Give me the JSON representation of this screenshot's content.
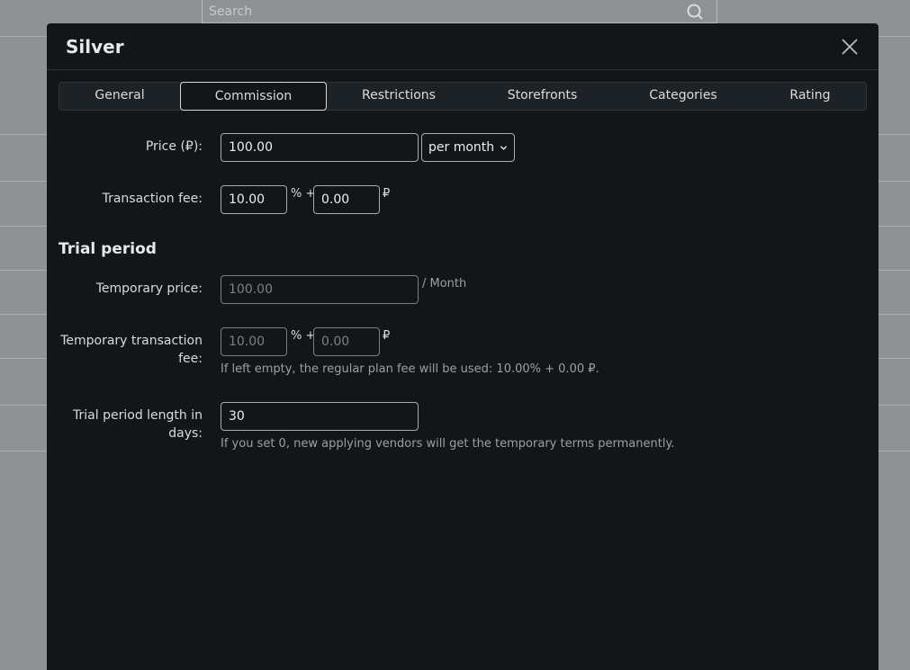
{
  "background": {
    "search_placeholder": "Search"
  },
  "modal": {
    "title": "Silver",
    "tabs": [
      {
        "label": "General"
      },
      {
        "label": "Commission"
      },
      {
        "label": "Restrictions"
      },
      {
        "label": "Storefronts"
      },
      {
        "label": "Categories"
      },
      {
        "label": "Rating"
      }
    ],
    "active_tab": "Commission",
    "price": {
      "label": "Price (₽):",
      "value": "100.00",
      "period": "per month"
    },
    "transaction_fee": {
      "label": "Transaction fee:",
      "percent": "10.00",
      "percent_suffix": "% +",
      "fixed": "0.00",
      "fixed_suffix": "₽"
    },
    "trial": {
      "title": "Trial period",
      "temp_price_label": "Temporary price:",
      "temp_price_placeholder": "100.00",
      "temp_price_suffix": "/ Month",
      "temp_fee_label_line1": "Temporary transaction",
      "temp_fee_label_line2": "fee:",
      "temp_fee_percent_placeholder": "10.00",
      "temp_fee_percent_suffix": "% +",
      "temp_fee_fixed_placeholder": "0.00",
      "temp_fee_fixed_suffix": "₽",
      "temp_fee_hint": "If left empty, the regular plan fee will be used: 10.00% + 0.00 ₽.",
      "length_label_line1": "Trial period length in",
      "length_label_line2": "days:",
      "length_value": "30",
      "length_hint": "If you set 0, new applying vendors will get the temporary terms permanently."
    }
  }
}
